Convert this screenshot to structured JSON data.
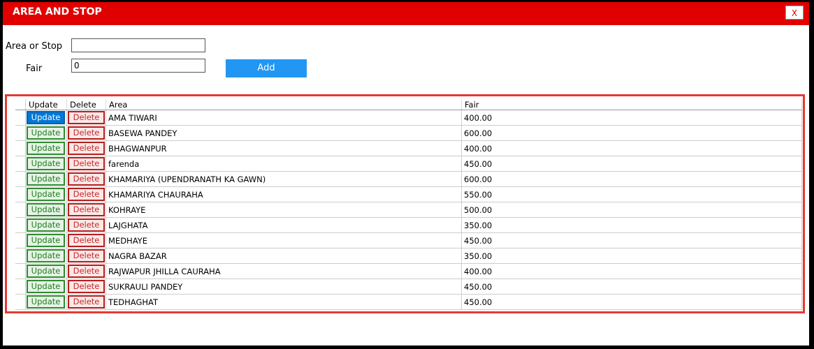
{
  "window": {
    "title": "AREA AND STOP",
    "close_label": "X"
  },
  "form": {
    "area_label": "Area or Stop",
    "area_value": "",
    "fair_label": "Fair",
    "fair_value": "0",
    "add_label": "Add"
  },
  "grid": {
    "columns": [
      "Update",
      "Delete",
      "Area",
      "Fair"
    ],
    "update_label": "Update",
    "delete_label": "Delete",
    "rows": [
      {
        "area": "AMA TIWARI",
        "fair": "400.00"
      },
      {
        "area": "BASEWA PANDEY",
        "fair": "600.00"
      },
      {
        "area": "BHAGWANPUR",
        "fair": "400.00"
      },
      {
        "area": "farenda",
        "fair": "450.00"
      },
      {
        "area": "KHAMARIYA (UPENDRANATH KA GAWN)",
        "fair": "600.00"
      },
      {
        "area": "KHAMARIYA CHAURAHA",
        "fair": "550.00"
      },
      {
        "area": "KOHRAYE",
        "fair": "500.00"
      },
      {
        "area": "LAJGHATA",
        "fair": "350.00"
      },
      {
        "area": "MEDHAYE",
        "fair": "450.00"
      },
      {
        "area": "NAGRA BAZAR",
        "fair": "350.00"
      },
      {
        "area": "RAJWAPUR JHILLA CAURAHA",
        "fair": "400.00"
      },
      {
        "area": "SUKRAULI PANDEY",
        "fair": "450.00"
      },
      {
        "area": "TEDHAGHAT",
        "fair": "450.00"
      }
    ]
  },
  "colors": {
    "titlebar": "#e00000",
    "add_button": "#2196f3",
    "grid_border": "#e53935"
  }
}
